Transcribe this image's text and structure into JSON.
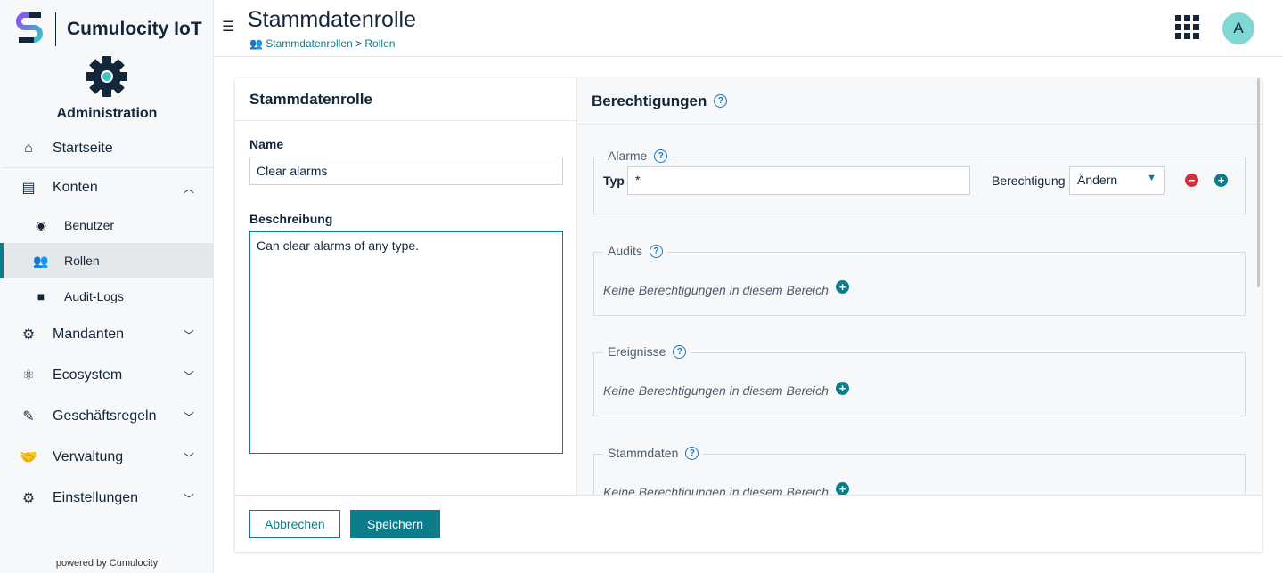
{
  "brand": {
    "name": "Cumulocity IoT"
  },
  "app": {
    "title": "Administration"
  },
  "nav": {
    "items": [
      {
        "label": "Startseite"
      },
      {
        "label": "Konten"
      },
      {
        "label": "Benutzer"
      },
      {
        "label": "Rollen"
      },
      {
        "label": "Audit-Logs"
      },
      {
        "label": "Mandanten"
      },
      {
        "label": "Ecosystem"
      },
      {
        "label": "Geschäftsregeln"
      },
      {
        "label": "Verwaltung"
      },
      {
        "label": "Einstellungen"
      }
    ]
  },
  "powered": "powered by Cumulocity",
  "header": {
    "title": "Stammdatenrolle",
    "breadcrumb": [
      "Stammdatenrollen",
      "Rollen"
    ],
    "breadcrumb_sep": ">",
    "avatar": "A"
  },
  "form": {
    "title": "Stammdatenrolle",
    "name_label": "Name",
    "name_value": "Clear alarms",
    "desc_label": "Beschreibung",
    "desc_value": "Can clear alarms of any type."
  },
  "permissions": {
    "title": "Berechtigungen",
    "empty": "Keine Berechtigungen in diesem Bereich",
    "alarms": {
      "label": "Alarme",
      "type_label": "Typ",
      "type_value": "*",
      "perm_label": "Berechtigung",
      "perm_value": "Ändern"
    },
    "audits": {
      "label": "Audits"
    },
    "events": {
      "label": "Ereignisse"
    },
    "inventory": {
      "label": "Stammdaten"
    }
  },
  "footer": {
    "cancel": "Abbrechen",
    "save": "Speichern"
  },
  "colors": {
    "accent": "#0b7d8a",
    "danger": "#d32f3c",
    "help": "#1776bf"
  }
}
